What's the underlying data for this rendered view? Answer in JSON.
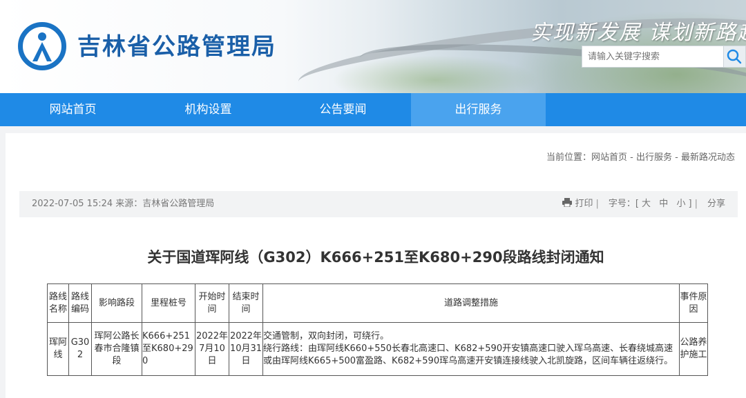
{
  "header": {
    "site_title": "吉林省公路管理局",
    "slogan": "实现新发展  谋划新路越",
    "logo_icon": "jilin-highway-logo",
    "search": {
      "placeholder": "请输入关键字搜索"
    }
  },
  "nav": {
    "items": [
      {
        "label": "网站首页"
      },
      {
        "label": "机构设置"
      },
      {
        "label": "公告要闻"
      },
      {
        "label": "出行服务",
        "active": true
      }
    ]
  },
  "breadcrumb": {
    "prefix": "当前位置：",
    "items": [
      "网站首页",
      "出行服务",
      "最新路况动态"
    ],
    "separator": " - "
  },
  "meta": {
    "date_source": "2022-07-05 15:24 来源：吉林省公路管理局",
    "print_label": "打印",
    "font_size_label": "字号：[",
    "font_large": "大",
    "font_medium": "中",
    "font_small": "小",
    "font_close": "]",
    "share_label": "分享"
  },
  "article": {
    "title": "关于国道珲阿线（G302）K666+251至K680+290段路线封闭通知"
  },
  "table": {
    "headers": [
      "路线名称",
      "路线编码",
      "影响路段",
      "里程桩号",
      "开始时间",
      "结束时间",
      "道路调整措施",
      "事件原因"
    ],
    "rows": [
      {
        "route_name": "珲阿线",
        "route_code": "G302",
        "affected_section": "珲阿公路长春市合隆镇段",
        "mileage": "K666+251至K680+290",
        "start_time": "2022年7月10日",
        "end_time": "2022年10月31日",
        "measures_line1": "交通管制，双向封闭，可绕行。",
        "measures_line2": "绕行路线：由珲阿线K660+550长春北高速口、K682+590开安镇高速口驶入珲乌高速、长春绕城高速或由珲阿线K665+500富盈路、K682+590珲乌高速开安镇连接线驶入北凯旋路，区间车辆往返绕行。",
        "reason": "公路养护施工"
      }
    ]
  },
  "colors": {
    "nav_bg": "#1f8ae6",
    "nav_active": "#4aa3ee",
    "title_blue": "#1a5fa8"
  }
}
